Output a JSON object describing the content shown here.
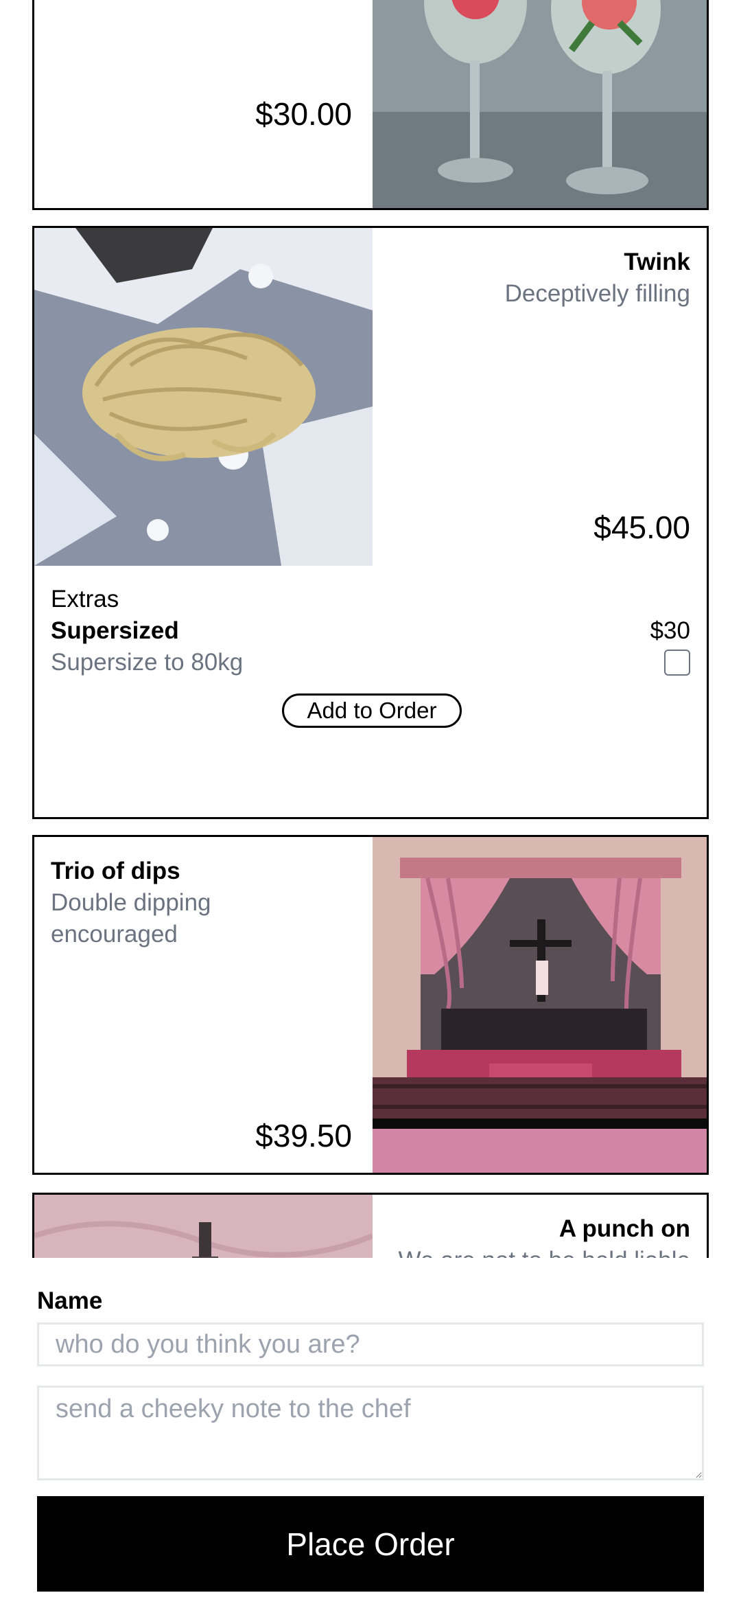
{
  "menu": {
    "items": [
      {
        "title": "",
        "description": "",
        "price": "$30.00"
      },
      {
        "title": "Twink",
        "description": "Deceptively filling",
        "price": "$45.00",
        "extras_label": "Extras",
        "extras": [
          {
            "name": "Supersized",
            "description": "Supersize to 80kg",
            "price": "$30",
            "checked": false
          }
        ],
        "add_label": "Add to Order"
      },
      {
        "title": "Trio of dips",
        "description": "Double dipping encouraged",
        "price": "$39.50"
      },
      {
        "title": "A punch on",
        "description": "We are not to be held liable"
      }
    ]
  },
  "order_form": {
    "name_label": "Name",
    "name_placeholder": "who do you think you are?",
    "note_placeholder": "send a cheeky note to the chef",
    "submit_label": "Place Order"
  },
  "colors": {
    "muted_text": "#6b7280",
    "border": "#000000",
    "input_border": "#e5e7eb",
    "button_bg": "#000000"
  }
}
